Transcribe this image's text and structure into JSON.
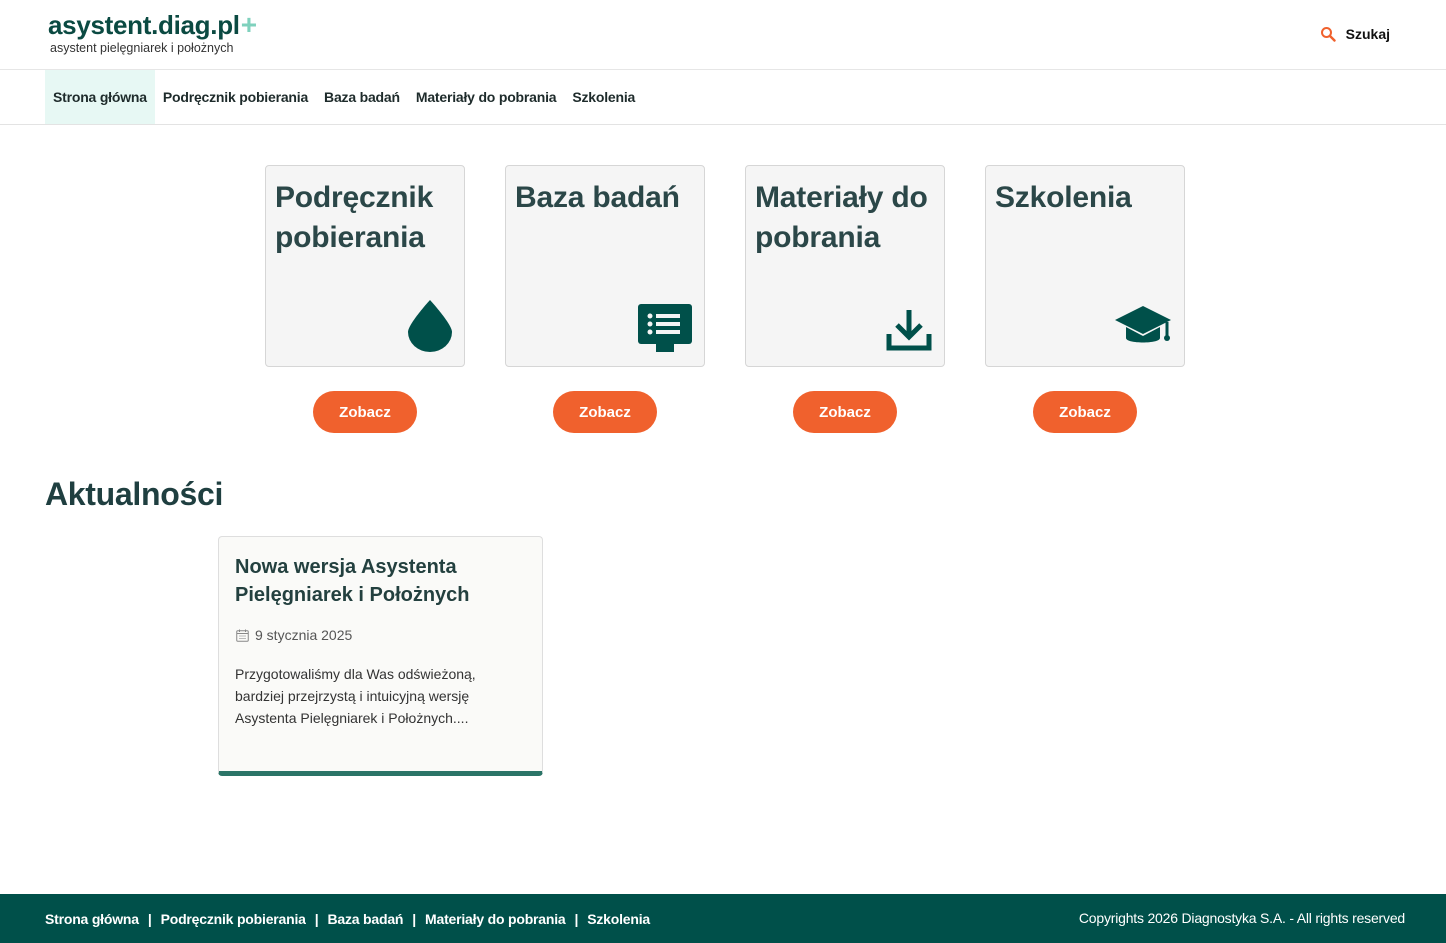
{
  "brand": {
    "name": "asystent.diag.pl",
    "plus": "+",
    "subtitle": "asystent pielęgniarek i położnych",
    "primary_color": "#00504a",
    "accent_color": "#f0612d"
  },
  "search": {
    "label": "Szukaj",
    "icon": "search-icon"
  },
  "nav": {
    "items": [
      {
        "label": "Strona główna",
        "active": true
      },
      {
        "label": "Podręcznik pobierania",
        "active": false
      },
      {
        "label": "Baza badań",
        "active": false
      },
      {
        "label": "Materiały do pobrania",
        "active": false
      },
      {
        "label": "Szkolenia",
        "active": false
      }
    ]
  },
  "cards": [
    {
      "title": "Podręcznik pobierania",
      "icon": "drop-icon",
      "button": "Zobacz"
    },
    {
      "title": "Baza badań",
      "icon": "list-screen-icon",
      "button": "Zobacz"
    },
    {
      "title": "Materiały do pobrania",
      "icon": "download-icon",
      "button": "Zobacz"
    },
    {
      "title": "Szkolenia",
      "icon": "graduation-cap-icon",
      "button": "Zobacz"
    }
  ],
  "news": {
    "heading": "Aktualności",
    "items": [
      {
        "title": "Nowa wersja Asystenta Pielęgniarek i Położnych",
        "date": "9 stycznia 2025",
        "excerpt": "Przygotowaliśmy dla Was odświeżoną, bardziej przejrzystą i intuicyjną wersję Asystenta Pielęgniarek i Położnych...."
      }
    ]
  },
  "footer": {
    "links": [
      "Strona główna",
      "Podręcznik pobierania",
      "Baza badań",
      "Materiały do pobrania",
      "Szkolenia"
    ],
    "separator": "|",
    "copyright": "Copyrights 2026 Diagnostyka S.A. - All rights reserved"
  }
}
